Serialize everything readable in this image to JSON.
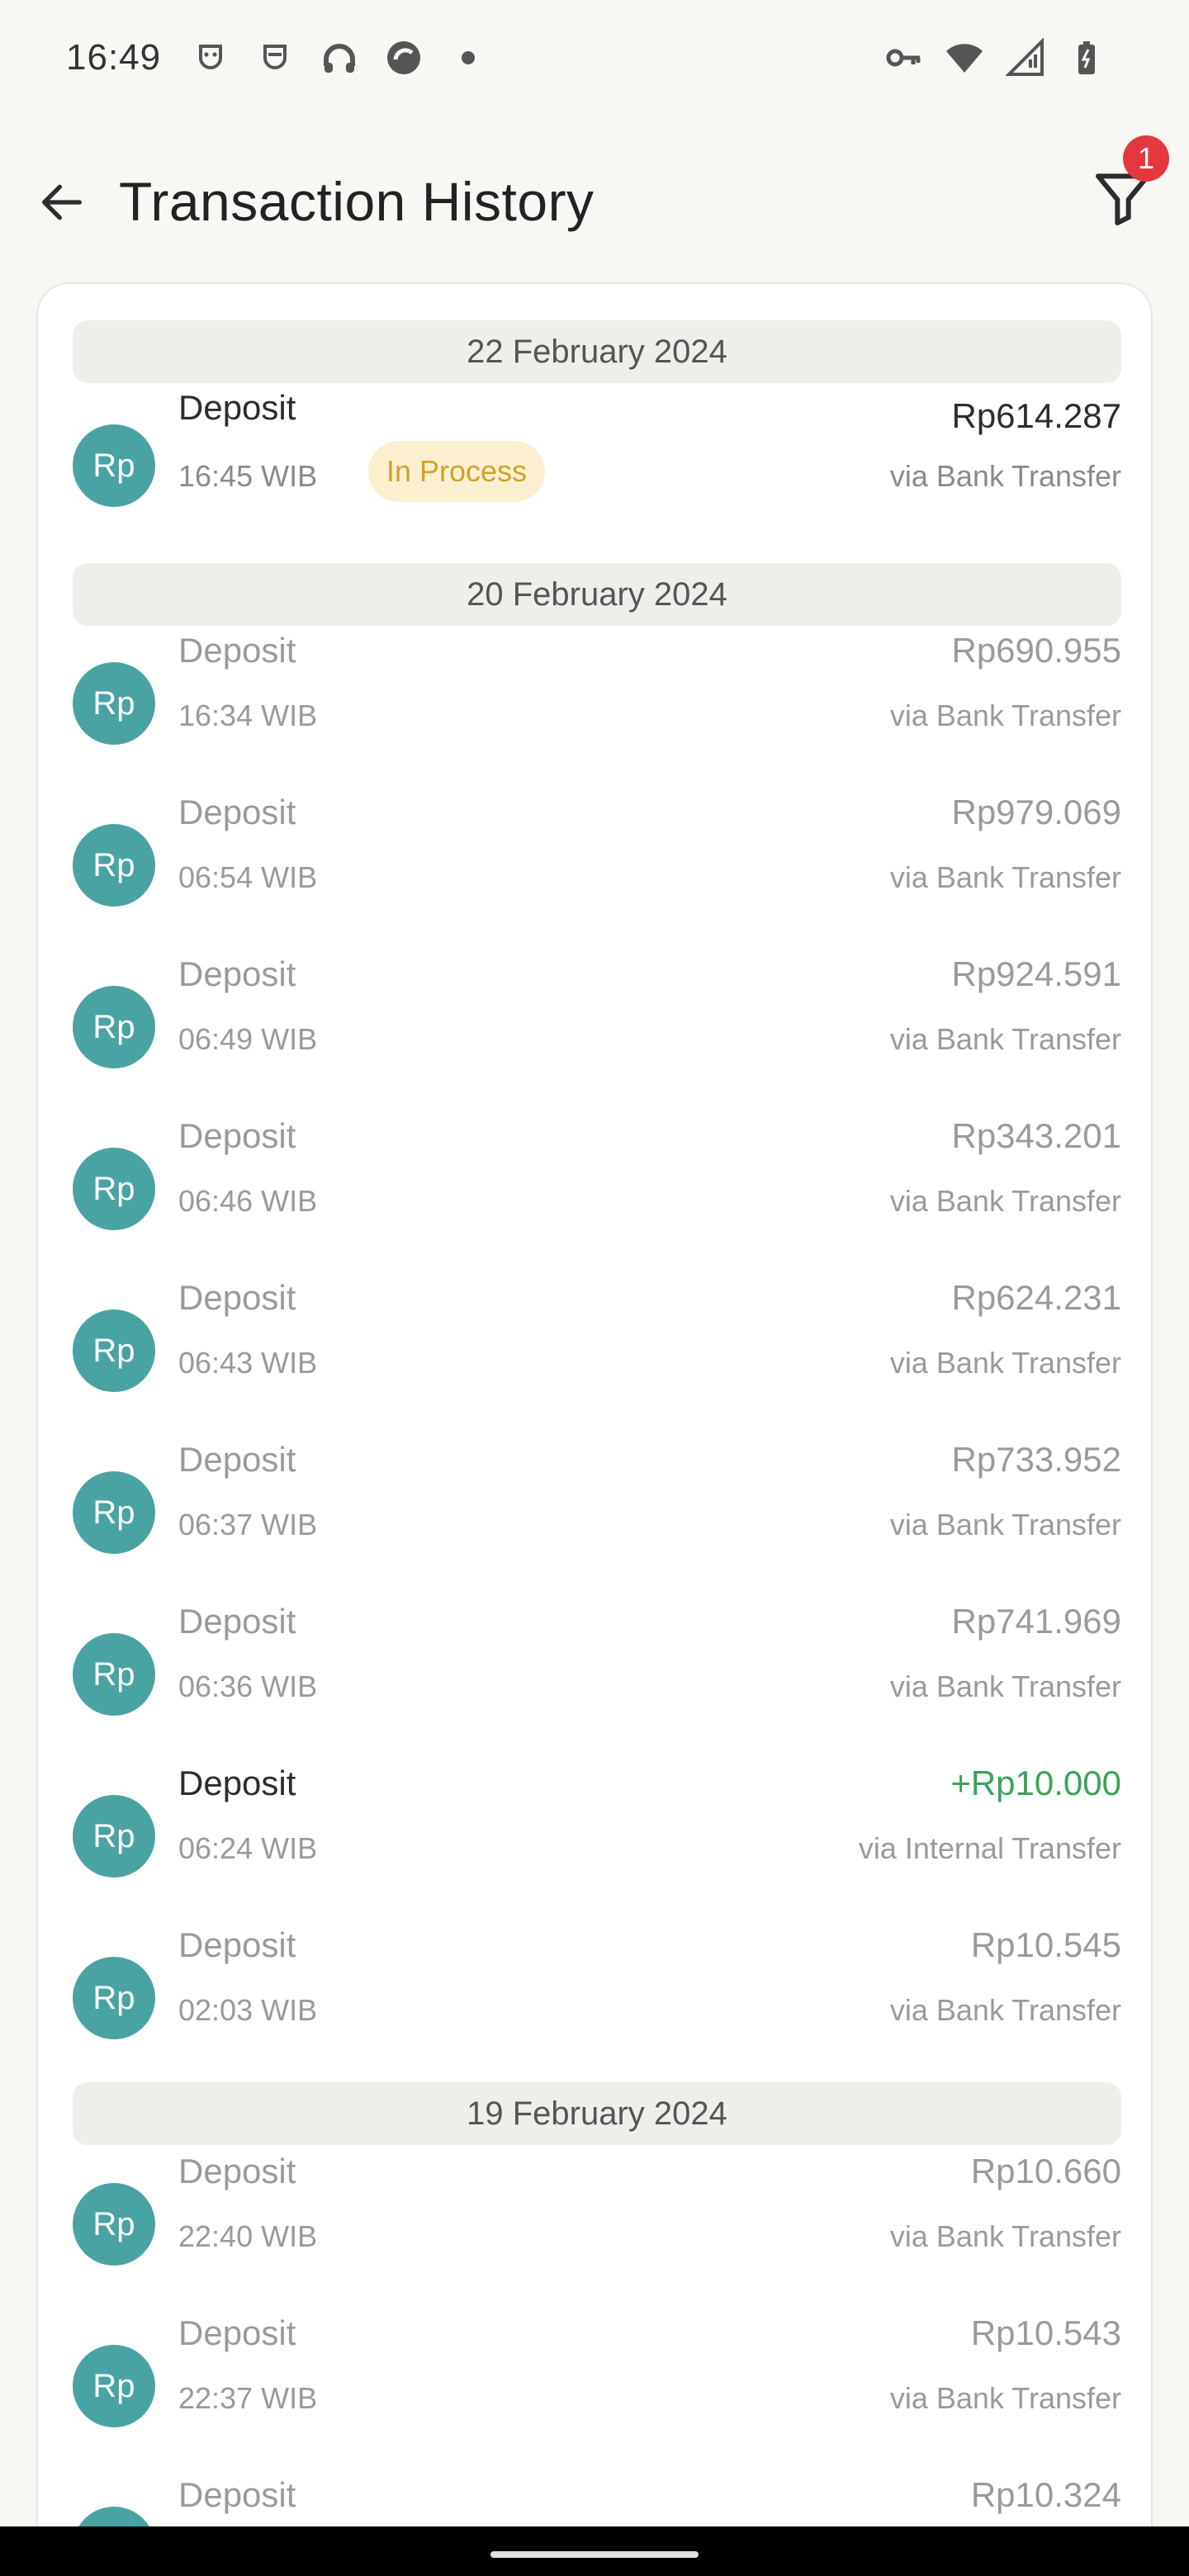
{
  "status_bar": {
    "time": "16:49",
    "left_icons": [
      "mask-icon",
      "mask-icon",
      "headphones-icon",
      "browser-icon",
      "dot-icon"
    ],
    "right_icons": [
      "key-icon",
      "wifi-icon",
      "signal-icon",
      "battery-icon"
    ]
  },
  "header": {
    "title": "Transaction History",
    "filter_badge": "1"
  },
  "groups": [
    {
      "date": "22 February 2024",
      "transactions": [
        {
          "avatar": "Rp",
          "title": "Deposit",
          "time": "16:45 WIB",
          "status": "In Process",
          "amount": "Rp614.287",
          "method": "via Bank Transfer",
          "style": "active"
        }
      ]
    },
    {
      "date": "20 February 2024",
      "transactions": [
        {
          "avatar": "Rp",
          "title": "Deposit",
          "time": "16:34 WIB",
          "amount": "Rp690.955",
          "method": "via Bank Transfer",
          "style": "muted"
        },
        {
          "avatar": "Rp",
          "title": "Deposit",
          "time": "06:54 WIB",
          "amount": "Rp979.069",
          "method": "via Bank Transfer",
          "style": "muted"
        },
        {
          "avatar": "Rp",
          "title": "Deposit",
          "time": "06:49 WIB",
          "amount": "Rp924.591",
          "method": "via Bank Transfer",
          "style": "muted"
        },
        {
          "avatar": "Rp",
          "title": "Deposit",
          "time": "06:46 WIB",
          "amount": "Rp343.201",
          "method": "via Bank Transfer",
          "style": "muted"
        },
        {
          "avatar": "Rp",
          "title": "Deposit",
          "time": "06:43 WIB",
          "amount": "Rp624.231",
          "method": "via Bank Transfer",
          "style": "muted"
        },
        {
          "avatar": "Rp",
          "title": "Deposit",
          "time": "06:37 WIB",
          "amount": "Rp733.952",
          "method": "via Bank Transfer",
          "style": "muted"
        },
        {
          "avatar": "Rp",
          "title": "Deposit",
          "time": "06:36 WIB",
          "amount": "Rp741.969",
          "method": "via Bank Transfer",
          "style": "muted"
        },
        {
          "avatar": "Rp",
          "title": "Deposit",
          "time": "06:24 WIB",
          "amount": "+Rp10.000",
          "method": "via Internal Transfer",
          "style": "credit"
        },
        {
          "avatar": "Rp",
          "title": "Deposit",
          "time": "02:03 WIB",
          "amount": "Rp10.545",
          "method": "via Bank Transfer",
          "style": "muted"
        }
      ]
    },
    {
      "date": "19 February 2024",
      "transactions": [
        {
          "avatar": "Rp",
          "title": "Deposit",
          "time": "22:40 WIB",
          "amount": "Rp10.660",
          "method": "via Bank Transfer",
          "style": "muted"
        },
        {
          "avatar": "Rp",
          "title": "Deposit",
          "time": "22:37 WIB",
          "amount": "Rp10.543",
          "method": "via Bank Transfer",
          "style": "muted"
        },
        {
          "avatar": "Rp",
          "title": "Deposit",
          "time": "",
          "amount": "Rp10.324",
          "method": "",
          "style": "muted"
        }
      ]
    }
  ],
  "colors": {
    "avatar_bg": "#4aa3a3",
    "credit_green": "#3aa35a",
    "badge_red": "#e5373f",
    "pill_bg": "#fbefcf",
    "pill_text": "#d1a12a"
  }
}
